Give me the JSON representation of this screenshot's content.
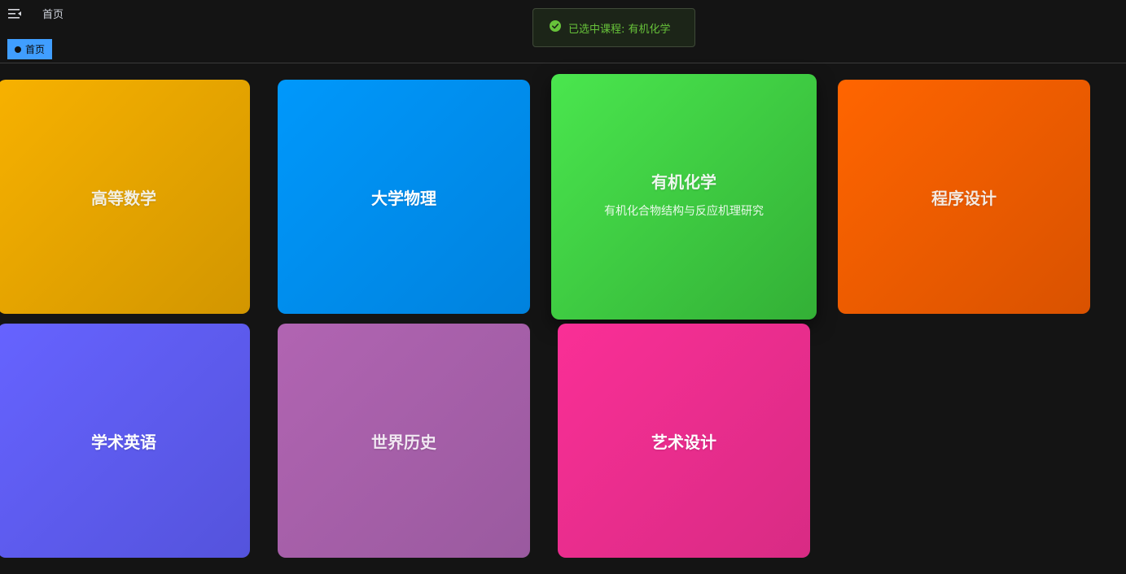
{
  "header": {
    "menu_icon": "menu-fold-icon",
    "breadcrumb": "首页"
  },
  "tags": [
    {
      "label": "首页",
      "active": true
    }
  ],
  "toast": {
    "icon": "check-circle-icon",
    "message": "已选中课程: 有机化学",
    "color": "#67c23a"
  },
  "courses": [
    {
      "title": "高等数学",
      "color_from": "#f7b100",
      "color_to": "#d29600"
    },
    {
      "title": "大学物理",
      "color_from": "#0098fb",
      "color_to": "#0082de"
    },
    {
      "title": "有机化学",
      "subtitle": "有机化合物结构与反应机理研究",
      "color_from": "#4ae64e",
      "color_to": "#33b036",
      "hovered": true
    },
    {
      "title": "程序设计",
      "color_from": "#ff6500",
      "color_to": "#d95200"
    },
    {
      "title": "学术英语",
      "color_from": "#6663ff",
      "color_to": "#5453dc"
    },
    {
      "title": "世界历史",
      "color_from": "#b164b2",
      "color_to": "#9a5a9f"
    },
    {
      "title": "艺术设计",
      "color_from": "#fa2f96",
      "color_to": "#d82b84"
    }
  ],
  "colors": {
    "background": "#141414",
    "accent": "#409eff",
    "success": "#67c23a"
  }
}
